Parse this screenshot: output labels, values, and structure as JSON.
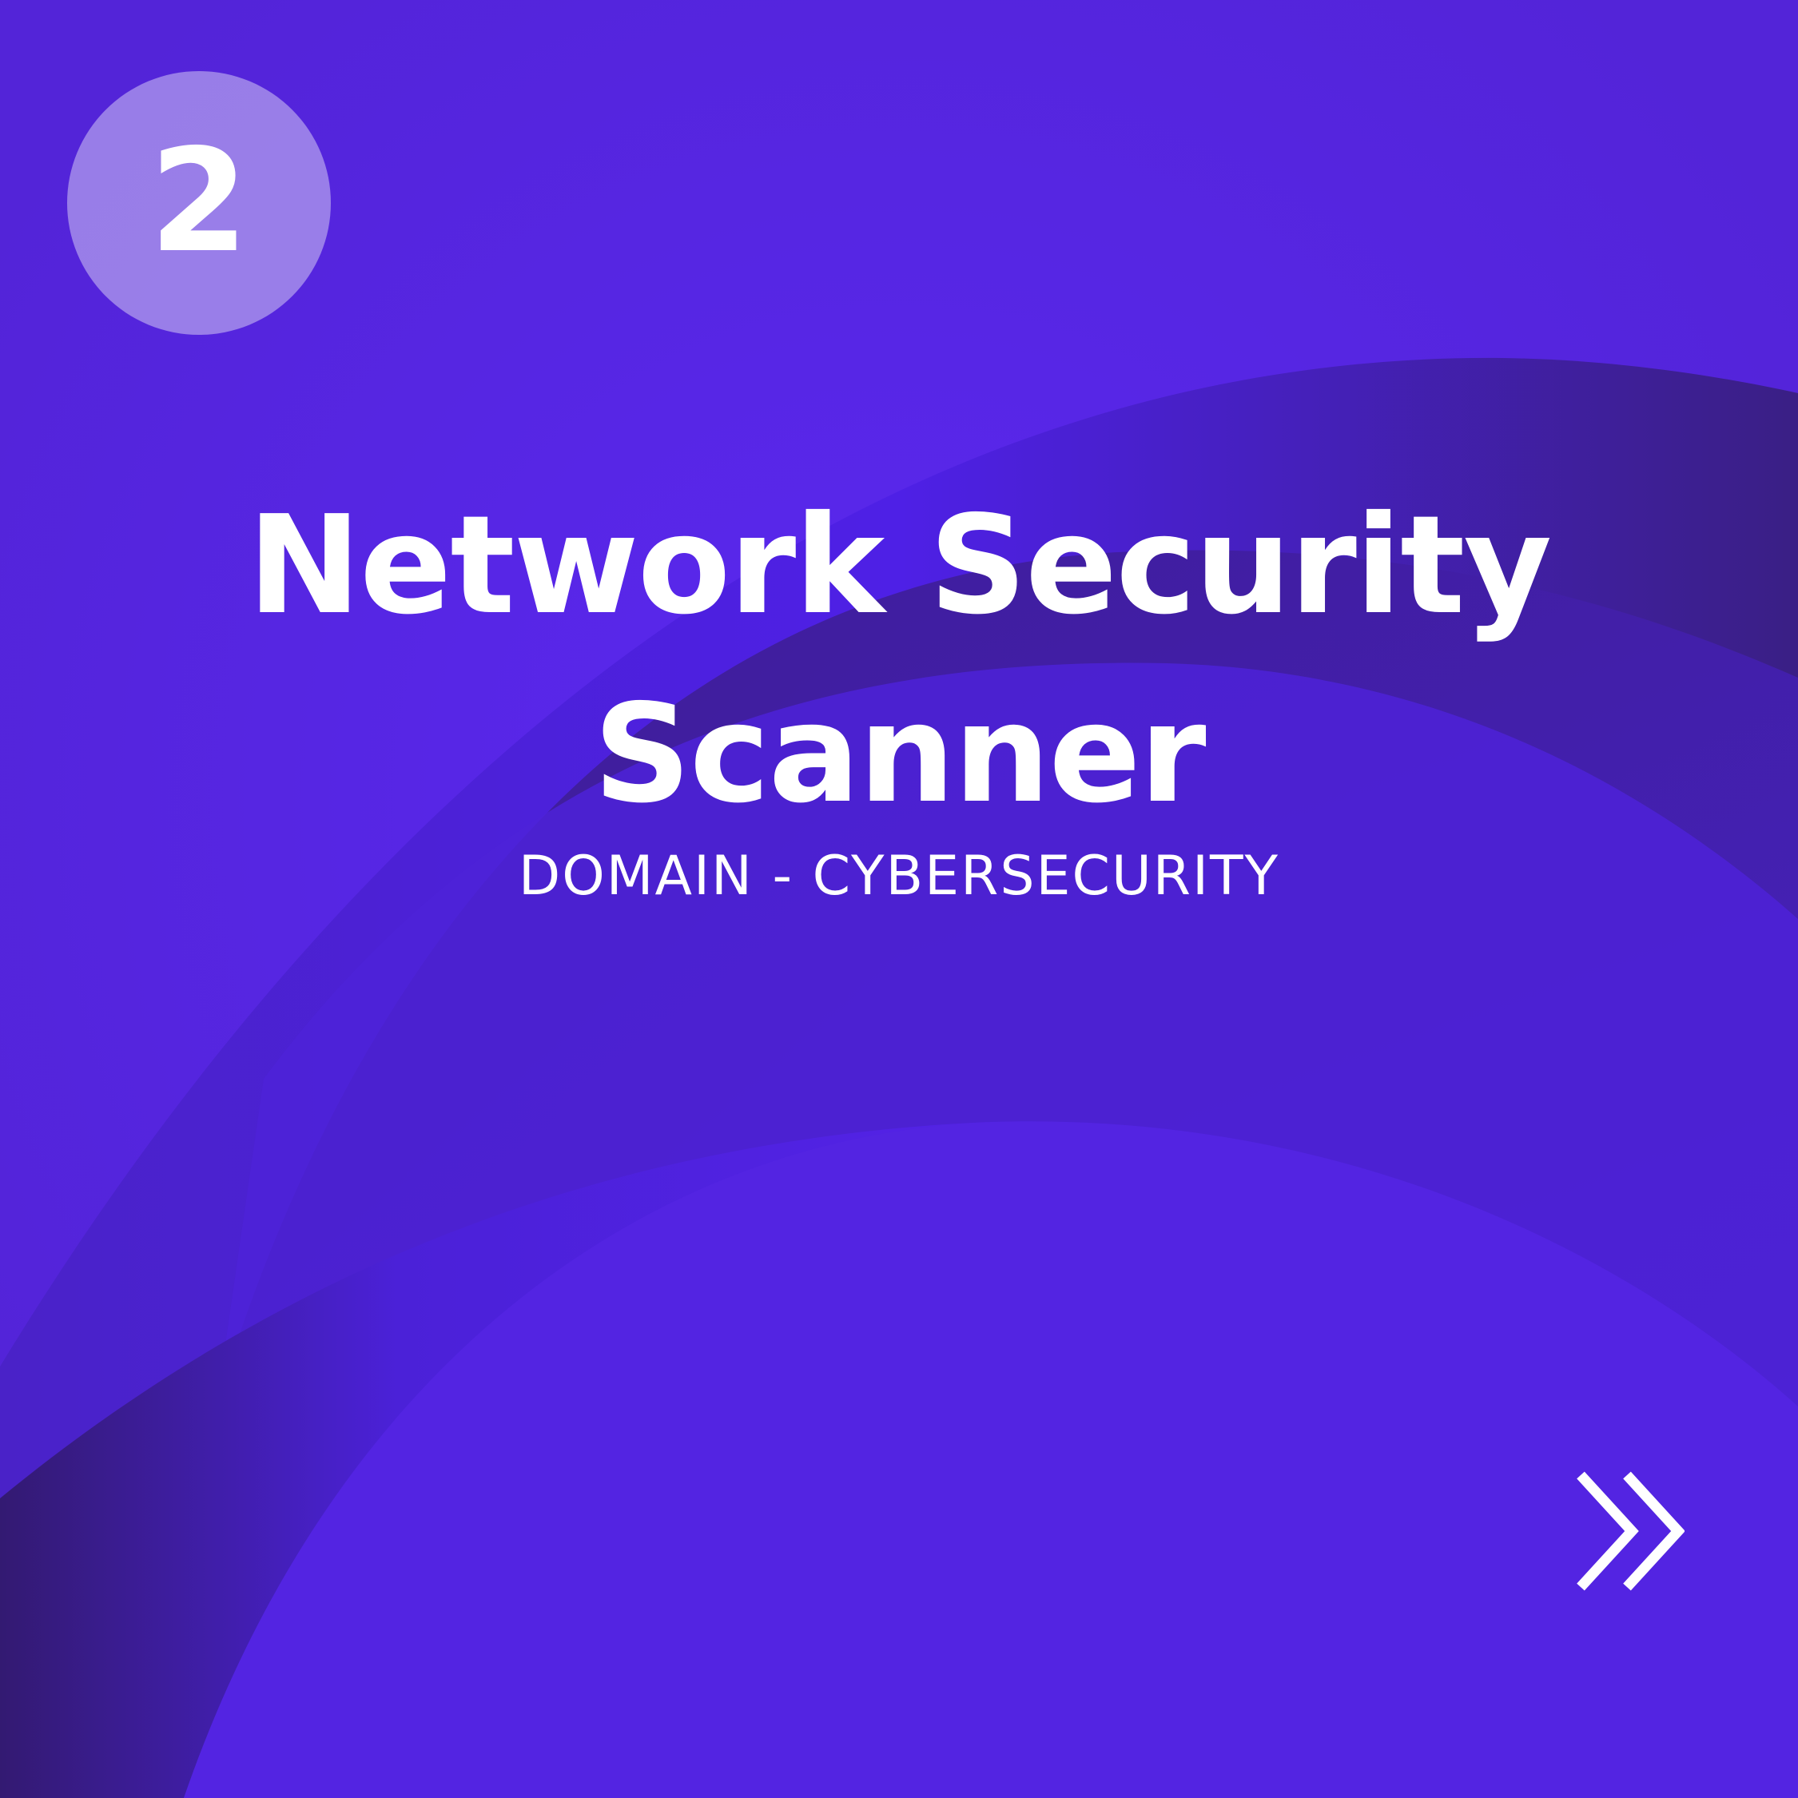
{
  "slide": {
    "number": "2",
    "title": "Network Security Scanner",
    "subtitle": "DOMAIN - CYBERSECURITY"
  },
  "icons": {
    "next": "double-chevron-right-icon"
  },
  "colors": {
    "background": "#5125e0",
    "badge": "#9b88e8",
    "text": "#ffffff"
  }
}
